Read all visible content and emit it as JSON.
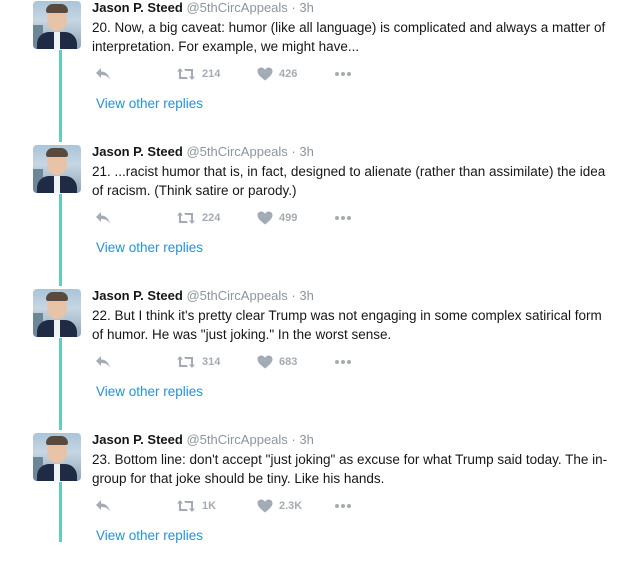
{
  "colors": {
    "thread_line": "#5fcdc1",
    "link": "#1c94e0",
    "muted": "#8a959e",
    "action_icon": "#a3acb5"
  },
  "icons": {
    "reply": "reply-arrow-icon",
    "retweet": "retweet-icon",
    "like": "heart-icon",
    "more": "more-dots-icon"
  },
  "tweets": [
    {
      "name": "Jason P. Steed",
      "handle": "@5thCircAppeals",
      "separator": "·",
      "time": "3h",
      "text": "20. Now, a big caveat: humor (like all language) is complicated and always a matter of interpretation. For example, we might have...",
      "retweets": "214",
      "likes": "426",
      "view_replies": "View other replies"
    },
    {
      "name": "Jason P. Steed",
      "handle": "@5thCircAppeals",
      "separator": "·",
      "time": "3h",
      "text": "21. ...racist humor that is, in fact, designed to alienate (rather than assimilate) the idea of racism. (Think satire or parody.)",
      "retweets": "224",
      "likes": "499",
      "view_replies": "View other replies"
    },
    {
      "name": "Jason P. Steed",
      "handle": "@5thCircAppeals",
      "separator": "·",
      "time": "3h",
      "text": "22. But I think it's pretty clear Trump was not engaging in some complex satirical form of humor. He was \"just joking.\" In the worst sense.",
      "retweets": "314",
      "likes": "683",
      "view_replies": "View other replies"
    },
    {
      "name": "Jason P. Steed",
      "handle": "@5thCircAppeals",
      "separator": "·",
      "time": "3h",
      "text": "23. Bottom line: don't accept \"just joking\" as excuse for what Trump said today. The in-group for that joke should be tiny. Like his hands.",
      "retweets": "1K",
      "likes": "2.3K",
      "view_replies": "View other replies"
    }
  ]
}
